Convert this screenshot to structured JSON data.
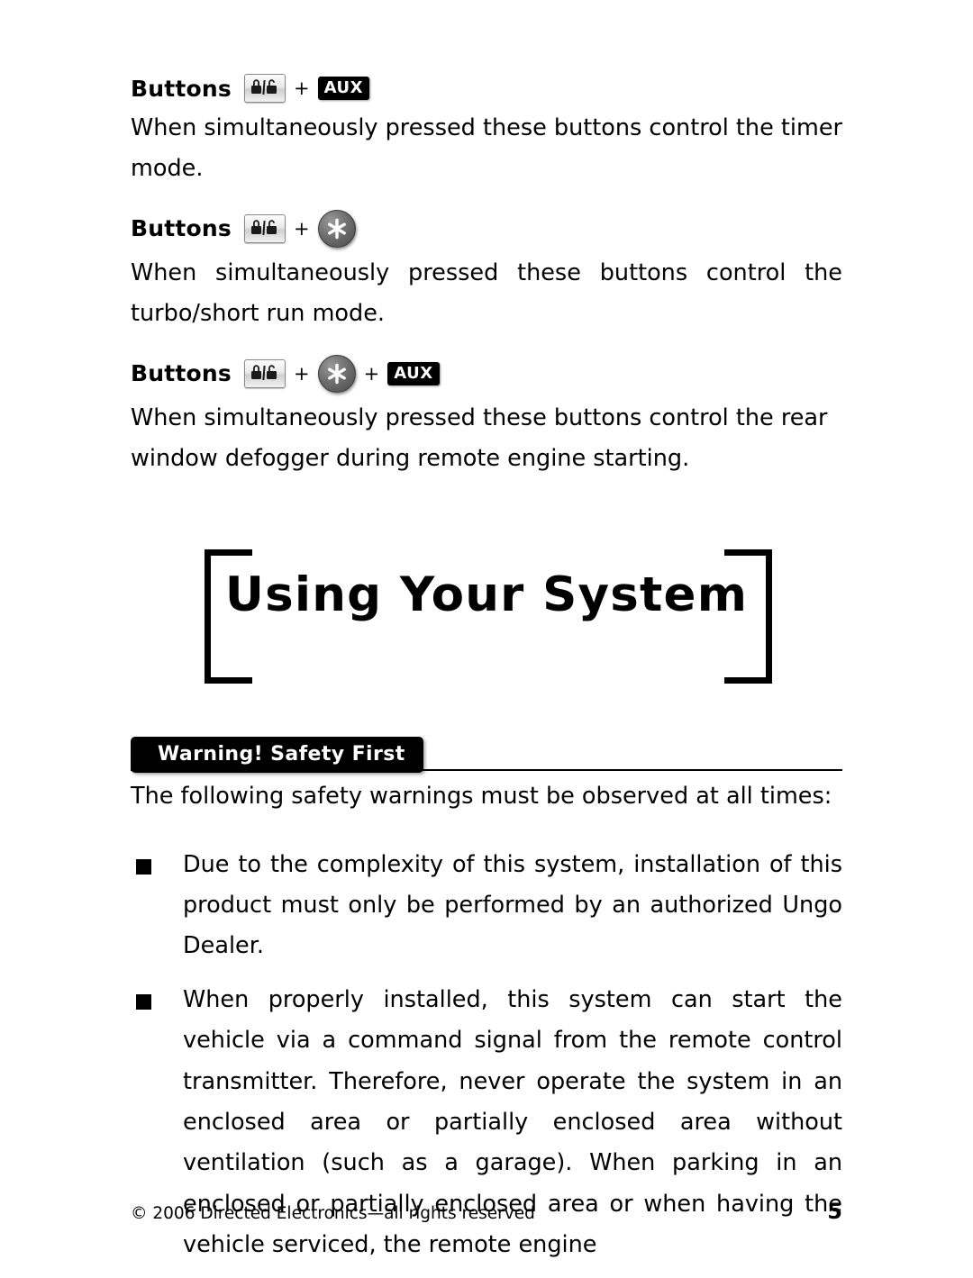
{
  "document": {
    "sections": [
      {
        "heading_word": "Buttons",
        "icons": [
          "lock-unlock-icon",
          "plus",
          "aux-button"
        ],
        "body": "When simultaneously pressed these buttons control the timer mode."
      },
      {
        "heading_word": "Buttons",
        "icons": [
          "lock-unlock-icon",
          "plus",
          "star-button"
        ],
        "body": "When simultaneously pressed these buttons control the turbo/short run mode."
      },
      {
        "heading_word": "Buttons",
        "icons": [
          "lock-unlock-icon",
          "plus",
          "star-button",
          "plus",
          "aux-button"
        ],
        "body": "When simultaneously pressed these buttons control the rear window defogger during remote engine starting."
      }
    ],
    "plus_symbol": "+",
    "aux_label": "AUX",
    "chapter_title": "Using Your System",
    "warning_tab": "Warning! Safety First",
    "intro": "The following safety warnings must be observed at all times:",
    "bullets": [
      "Due to the complexity of this system, installation of this product must only be performed by an authorized Ungo Dealer.",
      "When properly installed, this system can start the vehicle via a command signal from the remote control transmitter. Therefore, never operate the system in an enclosed area or partially enclosed area without ventilation (such as a garage). When parking in an enclosed or partially enclosed area or when having the vehicle serviced, the remote engine"
    ],
    "footer": {
      "copyright": "© 2006 Directed Electronics—all rights reserved",
      "page_number": "5"
    }
  }
}
